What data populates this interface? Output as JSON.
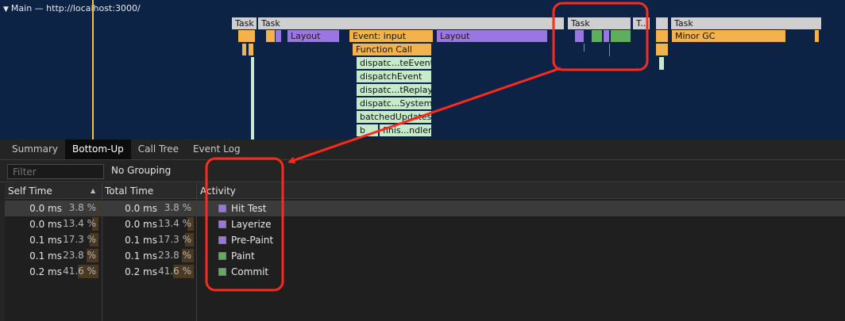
{
  "flame": {
    "thread_title": "Main — http://localhost:3000/",
    "blocks": {
      "task1": "Task",
      "task2": "Task",
      "task3": "Task",
      "task4": "T...",
      "task5": "Task",
      "layout1": "Layout",
      "event_input": "Event: input",
      "layout2": "Layout",
      "minor_gc": "Minor GC",
      "function_call": "Function Call",
      "stack": [
        "dispatc...teEvent",
        "dispatchEvent",
        "dispatc...tReplay",
        "dispatc...System",
        "batchedUpdates",
        "b",
        "finis...ndler"
      ]
    },
    "colors": {
      "background": "#0c2345",
      "task": "#cfcfcf",
      "scripting": "#f2b34d",
      "rendering": "#9a77e0",
      "painting": "#5fae5f",
      "cursor": "#f5c342"
    }
  },
  "tabs": [
    "Summary",
    "Bottom-Up",
    "Call Tree",
    "Event Log"
  ],
  "active_tab": "Bottom-Up",
  "filter": {
    "placeholder": "Filter",
    "grouping": "No Grouping"
  },
  "table": {
    "headers": {
      "self_time": "Self Time",
      "total_time": "Total Time",
      "activity": "Activity"
    },
    "rows": [
      {
        "self_ms": "0.0 ms",
        "self_pct": "3.8 %",
        "self_frac": 0.038,
        "total_ms": "0.0 ms",
        "total_pct": "3.8 %",
        "total_frac": 0.038,
        "activity": "Hit Test",
        "color": "#9a77e0"
      },
      {
        "self_ms": "0.0 ms",
        "self_pct": "13.4 %",
        "self_frac": 0.134,
        "total_ms": "0.0 ms",
        "total_pct": "13.4 %",
        "total_frac": 0.134,
        "activity": "Layerize",
        "color": "#9a77e0"
      },
      {
        "self_ms": "0.1 ms",
        "self_pct": "17.3 %",
        "self_frac": 0.173,
        "total_ms": "0.1 ms",
        "total_pct": "17.3 %",
        "total_frac": 0.173,
        "activity": "Pre-Paint",
        "color": "#9a77e0"
      },
      {
        "self_ms": "0.1 ms",
        "self_pct": "23.8 %",
        "self_frac": 0.238,
        "total_ms": "0.1 ms",
        "total_pct": "23.8 %",
        "total_frac": 0.238,
        "activity": "Paint",
        "color": "#5fae5f"
      },
      {
        "self_ms": "0.2 ms",
        "self_pct": "41.6 %",
        "self_frac": 0.416,
        "total_ms": "0.2 ms",
        "total_pct": "41.6 %",
        "total_frac": 0.416,
        "activity": "Commit",
        "color": "#5fae5f"
      }
    ]
  },
  "annotation_color": "#ff2a1f"
}
